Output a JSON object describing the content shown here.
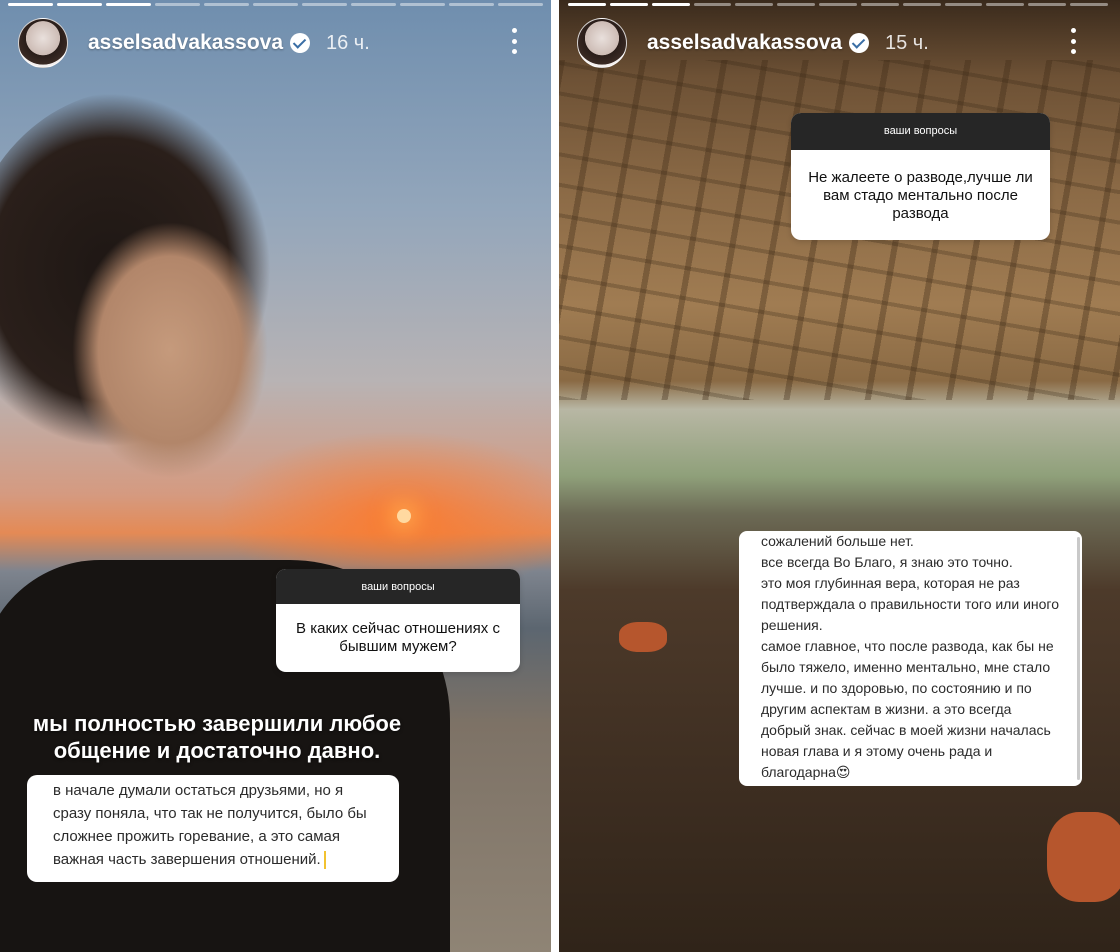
{
  "stories": [
    {
      "username": "asselsadvakassova",
      "time": "16 ч.",
      "progress_total": 11,
      "progress_done": 3,
      "question": {
        "header": "ваши вопросы",
        "text": "В каких сейчас отношениях с бывшим мужем?"
      },
      "answer_title": "мы полностью завершили любое общение и достаточно давно.",
      "answer_text": "в начале думали остаться друзьями, но я сразу поняла, что так не получится, было бы сложнее прожить горевание, а это самая важная часть завершения отношений."
    },
    {
      "username": "asselsadvakassova",
      "time": "15 ч.",
      "progress_total": 13,
      "progress_done": 3,
      "question": {
        "header": "ваши вопросы",
        "text": "Не жалеете о разводе,лучше ли вам стадо ментально  после развода"
      },
      "answer_lines": [
        "сожалений больше нет.",
        "все всегда Во Благо, я знаю это точно.",
        "это моя глубинная вера, которая не раз",
        "подтверждала о правильности того или иного",
        "решения.",
        "самое главное, что после развода, как бы не",
        "было тяжело, именно ментально, мне стало",
        "лучше. и по здоровью, по состоянию и по",
        "другим аспектам в жизни. а это всегда",
        "добрый знак. сейчас в моей жизни началась",
        "новая глава и я этому очень рада и",
        "благодарна😍"
      ]
    }
  ]
}
